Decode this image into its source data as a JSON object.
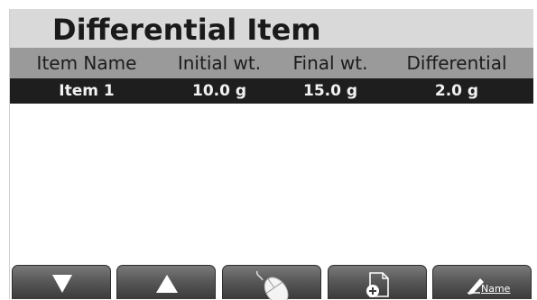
{
  "title": "Differential Item",
  "table": {
    "columns": [
      "Item Name",
      "Initial wt.",
      "Final wt.",
      "Differential"
    ],
    "rows": [
      {
        "name": "Item 1",
        "initial": "10.0 g",
        "final": "15.0 g",
        "differential": "2.0 g"
      }
    ]
  },
  "toolbar": {
    "buttons": [
      {
        "icon": "arrow-down-icon"
      },
      {
        "icon": "arrow-up-icon"
      },
      {
        "icon": "mouse-icon"
      },
      {
        "icon": "new-document-icon"
      },
      {
        "icon": "edit-name-icon",
        "label": "Name"
      }
    ]
  },
  "colors": {
    "title_bar": "#d9d9d9",
    "header_row": "#9a9a9a",
    "selected_row": "#1e1e1e",
    "button": "#5c5c5c"
  }
}
